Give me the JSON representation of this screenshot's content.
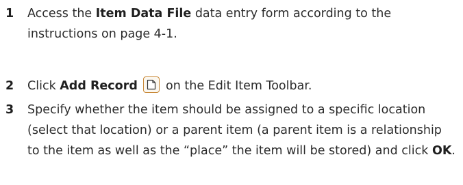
{
  "steps": [
    {
      "number": "1",
      "t1": "Access the ",
      "b1": "Item Data File",
      "t2": " data entry form according to the instructions on page 4-1."
    },
    {
      "number": "2",
      "t1": "Click ",
      "b1": "Add Record",
      "t2": " on the Edit Item Toolbar.",
      "icon": "add-record-icon"
    },
    {
      "number": "3",
      "t1": "Specify whether the item should be assigned to a specific location (select that location) or a parent item (a parent item is a relationship to the item as well as the “place” the item will be stored) and click ",
      "b1": "OK",
      "t2": "."
    }
  ]
}
